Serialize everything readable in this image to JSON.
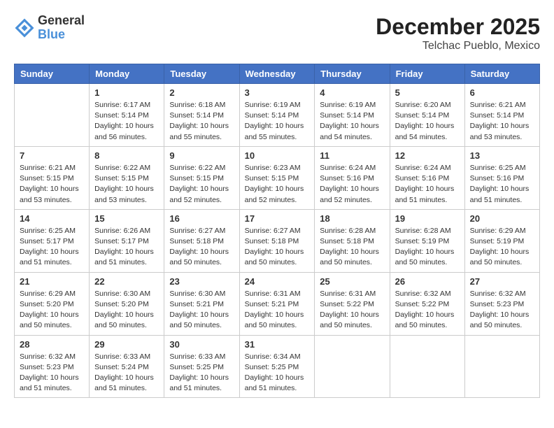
{
  "header": {
    "logo_line1": "General",
    "logo_line2": "Blue",
    "month": "December 2025",
    "location": "Telchac Pueblo, Mexico"
  },
  "weekdays": [
    "Sunday",
    "Monday",
    "Tuesday",
    "Wednesday",
    "Thursday",
    "Friday",
    "Saturday"
  ],
  "weeks": [
    [
      {
        "day": "",
        "empty": true
      },
      {
        "day": "1",
        "sunrise": "6:17 AM",
        "sunset": "5:14 PM",
        "daylight": "10 hours and 56 minutes."
      },
      {
        "day": "2",
        "sunrise": "6:18 AM",
        "sunset": "5:14 PM",
        "daylight": "10 hours and 55 minutes."
      },
      {
        "day": "3",
        "sunrise": "6:19 AM",
        "sunset": "5:14 PM",
        "daylight": "10 hours and 55 minutes."
      },
      {
        "day": "4",
        "sunrise": "6:19 AM",
        "sunset": "5:14 PM",
        "daylight": "10 hours and 54 minutes."
      },
      {
        "day": "5",
        "sunrise": "6:20 AM",
        "sunset": "5:14 PM",
        "daylight": "10 hours and 54 minutes."
      },
      {
        "day": "6",
        "sunrise": "6:21 AM",
        "sunset": "5:14 PM",
        "daylight": "10 hours and 53 minutes."
      }
    ],
    [
      {
        "day": "7",
        "sunrise": "6:21 AM",
        "sunset": "5:15 PM",
        "daylight": "10 hours and 53 minutes."
      },
      {
        "day": "8",
        "sunrise": "6:22 AM",
        "sunset": "5:15 PM",
        "daylight": "10 hours and 53 minutes."
      },
      {
        "day": "9",
        "sunrise": "6:22 AM",
        "sunset": "5:15 PM",
        "daylight": "10 hours and 52 minutes."
      },
      {
        "day": "10",
        "sunrise": "6:23 AM",
        "sunset": "5:15 PM",
        "daylight": "10 hours and 52 minutes."
      },
      {
        "day": "11",
        "sunrise": "6:24 AM",
        "sunset": "5:16 PM",
        "daylight": "10 hours and 52 minutes."
      },
      {
        "day": "12",
        "sunrise": "6:24 AM",
        "sunset": "5:16 PM",
        "daylight": "10 hours and 51 minutes."
      },
      {
        "day": "13",
        "sunrise": "6:25 AM",
        "sunset": "5:16 PM",
        "daylight": "10 hours and 51 minutes."
      }
    ],
    [
      {
        "day": "14",
        "sunrise": "6:25 AM",
        "sunset": "5:17 PM",
        "daylight": "10 hours and 51 minutes."
      },
      {
        "day": "15",
        "sunrise": "6:26 AM",
        "sunset": "5:17 PM",
        "daylight": "10 hours and 51 minutes."
      },
      {
        "day": "16",
        "sunrise": "6:27 AM",
        "sunset": "5:18 PM",
        "daylight": "10 hours and 50 minutes."
      },
      {
        "day": "17",
        "sunrise": "6:27 AM",
        "sunset": "5:18 PM",
        "daylight": "10 hours and 50 minutes."
      },
      {
        "day": "18",
        "sunrise": "6:28 AM",
        "sunset": "5:18 PM",
        "daylight": "10 hours and 50 minutes."
      },
      {
        "day": "19",
        "sunrise": "6:28 AM",
        "sunset": "5:19 PM",
        "daylight": "10 hours and 50 minutes."
      },
      {
        "day": "20",
        "sunrise": "6:29 AM",
        "sunset": "5:19 PM",
        "daylight": "10 hours and 50 minutes."
      }
    ],
    [
      {
        "day": "21",
        "sunrise": "6:29 AM",
        "sunset": "5:20 PM",
        "daylight": "10 hours and 50 minutes."
      },
      {
        "day": "22",
        "sunrise": "6:30 AM",
        "sunset": "5:20 PM",
        "daylight": "10 hours and 50 minutes."
      },
      {
        "day": "23",
        "sunrise": "6:30 AM",
        "sunset": "5:21 PM",
        "daylight": "10 hours and 50 minutes."
      },
      {
        "day": "24",
        "sunrise": "6:31 AM",
        "sunset": "5:21 PM",
        "daylight": "10 hours and 50 minutes."
      },
      {
        "day": "25",
        "sunrise": "6:31 AM",
        "sunset": "5:22 PM",
        "daylight": "10 hours and 50 minutes."
      },
      {
        "day": "26",
        "sunrise": "6:32 AM",
        "sunset": "5:22 PM",
        "daylight": "10 hours and 50 minutes."
      },
      {
        "day": "27",
        "sunrise": "6:32 AM",
        "sunset": "5:23 PM",
        "daylight": "10 hours and 50 minutes."
      }
    ],
    [
      {
        "day": "28",
        "sunrise": "6:32 AM",
        "sunset": "5:23 PM",
        "daylight": "10 hours and 51 minutes."
      },
      {
        "day": "29",
        "sunrise": "6:33 AM",
        "sunset": "5:24 PM",
        "daylight": "10 hours and 51 minutes."
      },
      {
        "day": "30",
        "sunrise": "6:33 AM",
        "sunset": "5:25 PM",
        "daylight": "10 hours and 51 minutes."
      },
      {
        "day": "31",
        "sunrise": "6:34 AM",
        "sunset": "5:25 PM",
        "daylight": "10 hours and 51 minutes."
      },
      {
        "day": "",
        "empty": true
      },
      {
        "day": "",
        "empty": true
      },
      {
        "day": "",
        "empty": true
      }
    ]
  ],
  "labels": {
    "sunrise_prefix": "Sunrise: ",
    "sunset_prefix": "Sunset: ",
    "daylight_prefix": "Daylight: "
  }
}
